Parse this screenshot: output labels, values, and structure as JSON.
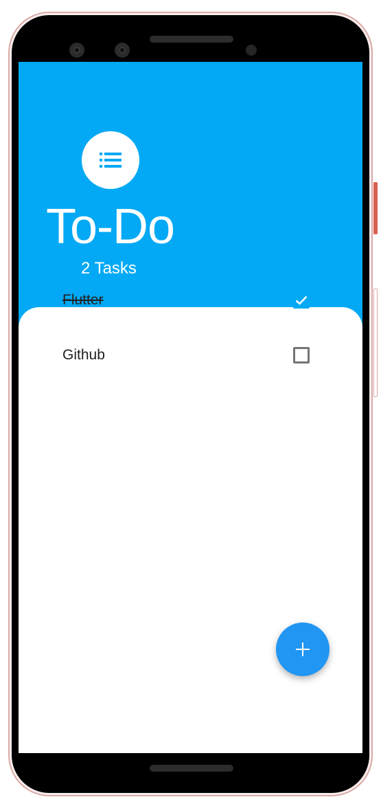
{
  "app": {
    "title": "To-Do",
    "subtitle": "2 Tasks"
  },
  "tasks": [
    {
      "label": "Flutter",
      "checked": true
    },
    {
      "label": "Github",
      "checked": false
    }
  ],
  "icons": {
    "header": "list-icon",
    "fab": "plus-icon"
  },
  "colors": {
    "header_bg": "#03a9f4",
    "fab": "#2196f3",
    "checkbox_checked": "#03a9f4"
  }
}
